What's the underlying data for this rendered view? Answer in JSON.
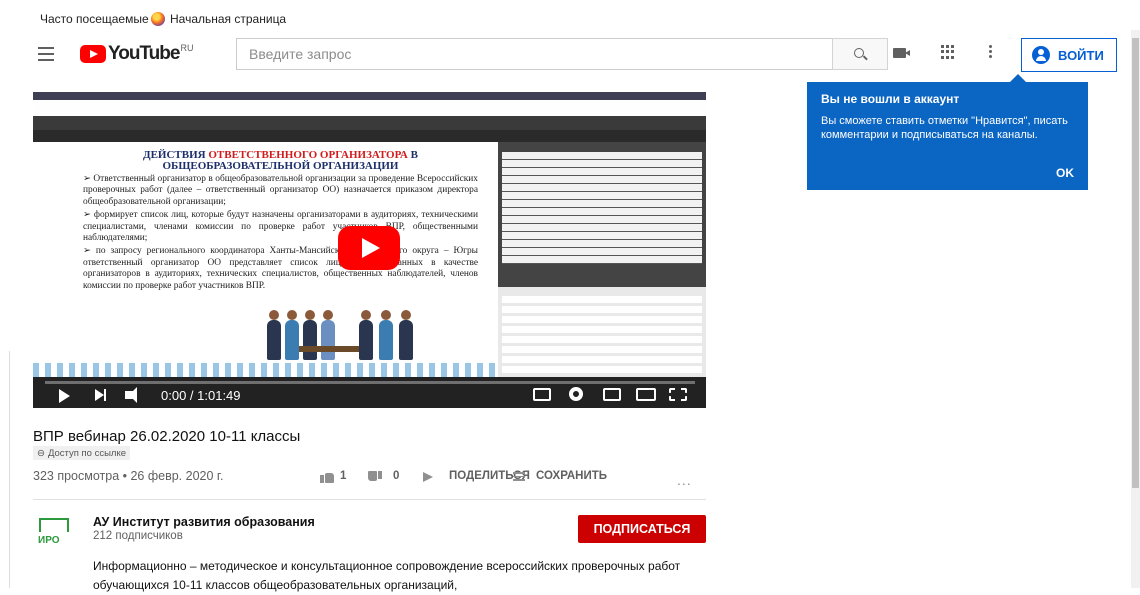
{
  "bookmarks": [
    {
      "label": "Часто посещаемые"
    },
    {
      "label": "Начальная страница"
    }
  ],
  "header": {
    "logo_text": "YouTube",
    "logo_region": "RU",
    "search_placeholder": "Введите запрос",
    "signin_label": "ВОЙТИ"
  },
  "popup": {
    "title": "Вы не вошли в аккаунт",
    "text": "Вы сможете ставить отметки \"Нравится\", писать комментарии и подписываться на каналы.",
    "ok_label": "OK"
  },
  "player": {
    "time": "0:00 / 1:01:49",
    "progress": 0,
    "slide": {
      "title_part1": "ДЕЙСТВИЯ ",
      "title_red": "ОТВЕТСТВЕННОГО ОРГАНИЗАТОРА",
      "title_part2": " В ОБЩЕОБРАЗОВАТЕЛЬНОЙ ОРГАНИЗАЦИИ",
      "p1": "➢ Ответственный организатор в общеобразовательной организации за проведение Всероссийских проверочных работ (далее – ответственный организатор ОО) назначается приказом директора общеобразовательной организации;",
      "p2": "➢ формирует список лиц, которые будут назначены организаторами в аудиториях, техническими специалистами, членами комиссии по проверке работ участников ВПР, общественными наблюдателями;",
      "p3": "➢ по запросу регионального координатора Ханты-Мансийского автономного округа – Югры ответственный организатор ОО представляет список лиц, рекомендованных в качестве организаторов в аудиториях, технических специалистов, общественных наблюдателей, членов комиссии по проверке работ участников ВПР."
    }
  },
  "video_info": {
    "title": "ВПР вебинар 26.02.2020 10-11 классы",
    "access": "Доступ по ссылке",
    "views_date": "323 просмотра • 26 февр. 2020 г.",
    "likes": "1",
    "dislikes": "0",
    "share_label": "ПОДЕЛИТЬСЯ",
    "save_label": "СОХРАНИТЬ",
    "more": "..."
  },
  "channel": {
    "name": "АУ Институт развития образования",
    "subscribers": "212 подписчиков",
    "logo_text": "ИРО",
    "subscribe_label": "ПОДПИСАТЬСЯ",
    "description": "Информационно – методическое и консультационное сопровождение всероссийских проверочных работ обучающихся 10-11 классов общеобразовательных организаций,"
  },
  "colors": {
    "brand_red": "#ff0000",
    "subscribe_red": "#cc0000",
    "popup_blue": "#0b65c2",
    "link_blue": "#065fd4"
  }
}
